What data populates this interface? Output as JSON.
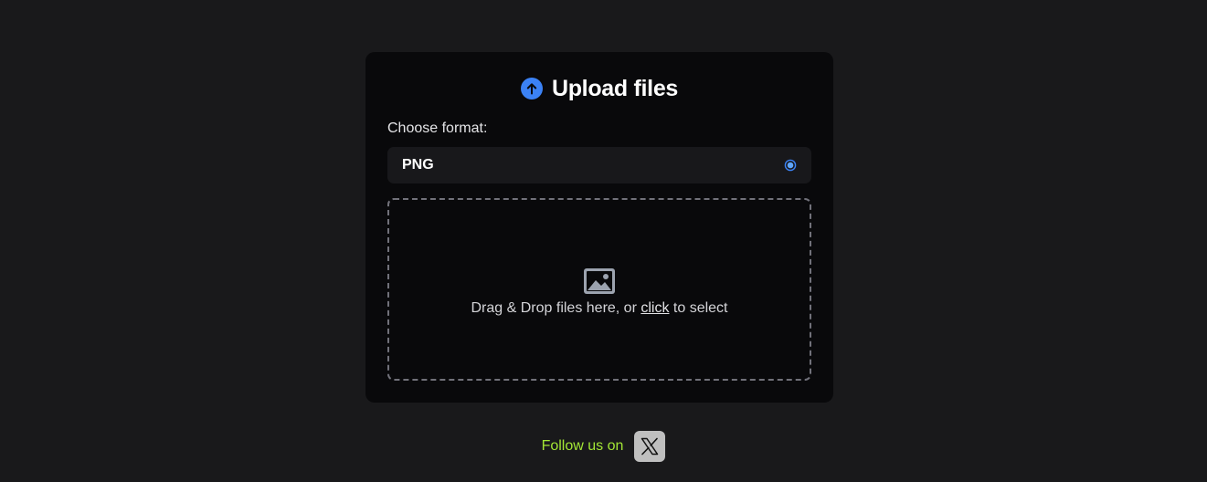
{
  "card": {
    "title": "Upload files",
    "format_label": "Choose format:",
    "format_selected": "PNG",
    "drop_text_before": "Drag & Drop files here, or ",
    "drop_link": "click",
    "drop_text_after": " to select"
  },
  "footer": {
    "follow_text": "Follow us on"
  },
  "icons": {
    "title_icon": "arrow-up-circle-icon",
    "select_indicator": "radio-selected-icon",
    "dropzone_icon": "image-icon",
    "social_icon": "x-logo-icon"
  },
  "colors": {
    "background": "#19191b",
    "card": "#09090b",
    "accent": "#3b82f6",
    "follow_text": "#a3e635"
  }
}
